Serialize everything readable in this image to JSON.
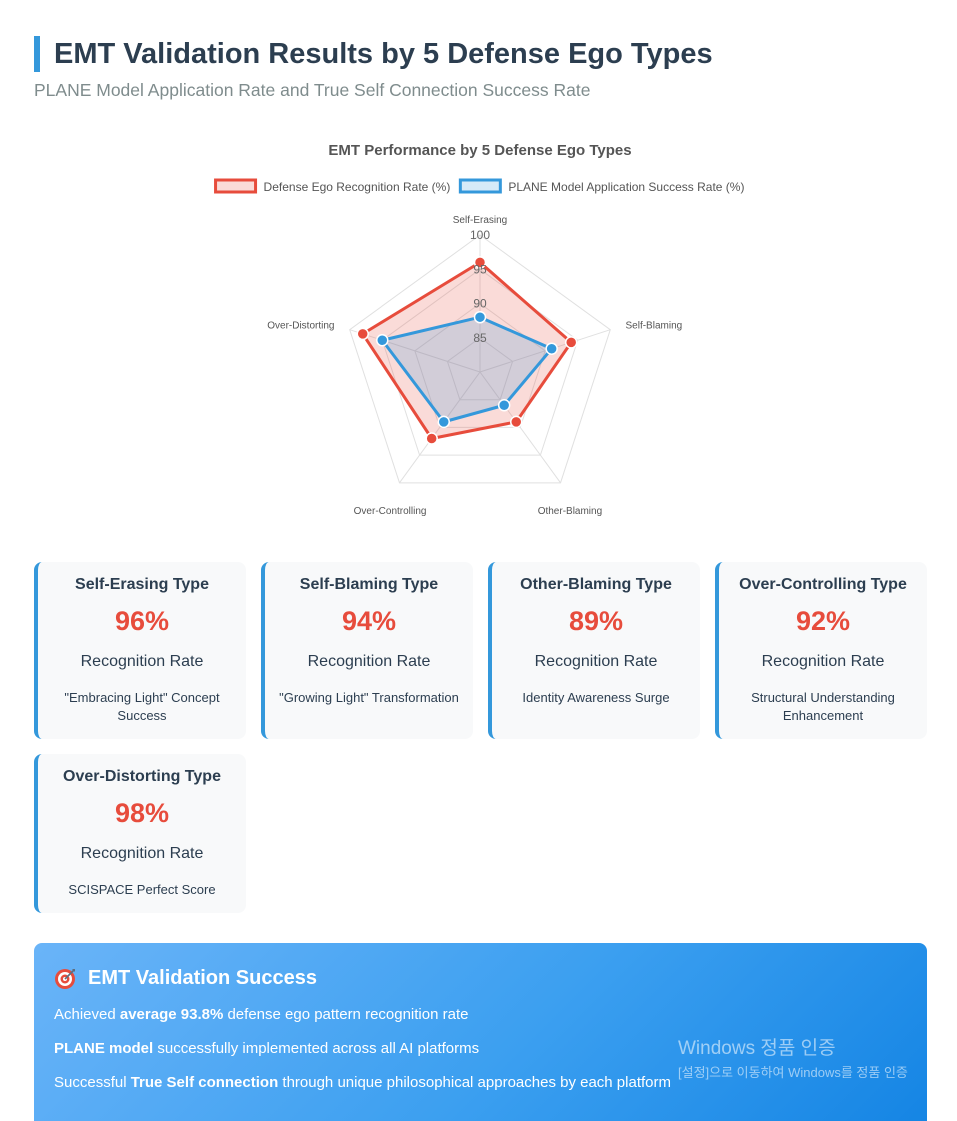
{
  "header": {
    "title": "EMT Validation Results by 5 Defense Ego Types",
    "subtitle": "PLANE Model Application Rate and True Self Connection Success Rate"
  },
  "chart_data": {
    "type": "radar",
    "title": "EMT Performance by 5 Defense Ego Types",
    "categories": [
      "Self-Erasing",
      "Self-Blaming",
      "Other-Blaming",
      "Over-Controlling",
      "Over-Distorting"
    ],
    "series": [
      {
        "name": "Defense Ego Recognition Rate (%)",
        "values": [
          96,
          94,
          89,
          92,
          98
        ],
        "color": "#e74c3c",
        "fill": "rgba(231,76,60,0.2)"
      },
      {
        "name": "PLANE Model Application Success Rate (%)",
        "values": [
          88,
          91,
          86,
          89,
          95
        ],
        "color": "#3498db",
        "fill": "rgba(52,152,219,0.2)"
      }
    ],
    "r_ticks": [
      "85",
      "90",
      "95",
      "100"
    ],
    "rlim": [
      80,
      100
    ],
    "grid": true,
    "legend_position": "top"
  },
  "cards": [
    {
      "title": "Self-Erasing Type",
      "pct": "96%",
      "label": "Recognition Rate",
      "desc": "\"Embracing Light\" Concept Success"
    },
    {
      "title": "Self-Blaming Type",
      "pct": "94%",
      "label": "Recognition Rate",
      "desc": "\"Growing Light\" Transformation"
    },
    {
      "title": "Other-Blaming Type",
      "pct": "89%",
      "label": "Recognition Rate",
      "desc": "Identity Awareness Surge"
    },
    {
      "title": "Over-Controlling Type",
      "pct": "92%",
      "label": "Recognition Rate",
      "desc": "Structural Understanding Enhancement"
    },
    {
      "title": "Over-Distorting Type",
      "pct": "98%",
      "label": "Recognition Rate",
      "desc": "SCISPACE Perfect Score"
    }
  ],
  "banner": {
    "icon": "target-icon",
    "title": "EMT Validation Success",
    "line1": {
      "pre": "Achieved ",
      "bold": "average 93.8%",
      "post": " defense ego pattern recognition rate"
    },
    "line2": {
      "pre": "",
      "bold": "PLANE model",
      "post": " successfully implemented across all AI platforms"
    },
    "line3": {
      "pre": "Successful ",
      "bold": "True Self connection",
      "post": " through unique philosophical approaches by each platform"
    }
  },
  "watermark": {
    "line1": "Windows 정품 인증",
    "line2": "[설정]으로 이동하여 Windows를 정품 인증"
  }
}
